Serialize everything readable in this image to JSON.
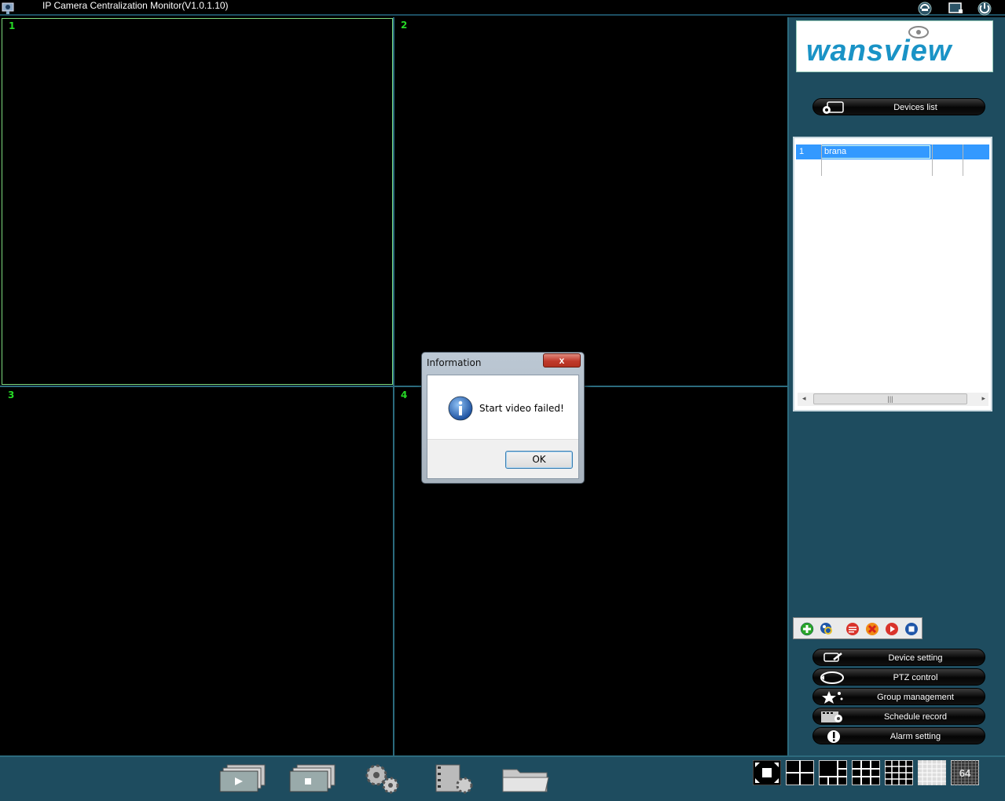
{
  "app": {
    "title": "IP Camera Centralization Monitor(V1.0.1.10)",
    "logo_text": "wansview"
  },
  "titlebar_buttons": [
    "refresh-icon",
    "display-icon",
    "power-icon"
  ],
  "video": {
    "channels": [
      "1",
      "2",
      "3",
      "4"
    ]
  },
  "right_panel": {
    "devices_list_label": "Devices list",
    "devices": [
      {
        "index": "1",
        "name": "brana"
      }
    ],
    "mini_tools": [
      "add-icon",
      "search-device-icon",
      "edit-icon",
      "delete-icon",
      "play-icon",
      "stop-icon"
    ],
    "menu": {
      "device_setting": "Device setting",
      "ptz_control": "PTZ control",
      "group_management": "Group management",
      "schedule_record": "Schedule record",
      "alarm_setting": "Alarm setting"
    }
  },
  "bottom": {
    "tools": [
      "play-all-icon",
      "stop-all-icon",
      "settings-icon",
      "record-icon",
      "folder-icon"
    ],
    "layouts": [
      "fullscreen-icon",
      "layout-4-icon",
      "layout-6-icon",
      "layout-9-icon",
      "layout-16-icon",
      "layout-36-icon",
      "layout-64-icon"
    ],
    "layout_64_label": "64"
  },
  "dialog": {
    "title": "Information",
    "close": "x",
    "message": "Start video failed!",
    "ok": "OK"
  },
  "colors": {
    "panel": "#1e4c5f",
    "grid_line": "#2b6b7e",
    "channel_number": "#26d926",
    "selected_row": "#3399ff"
  }
}
